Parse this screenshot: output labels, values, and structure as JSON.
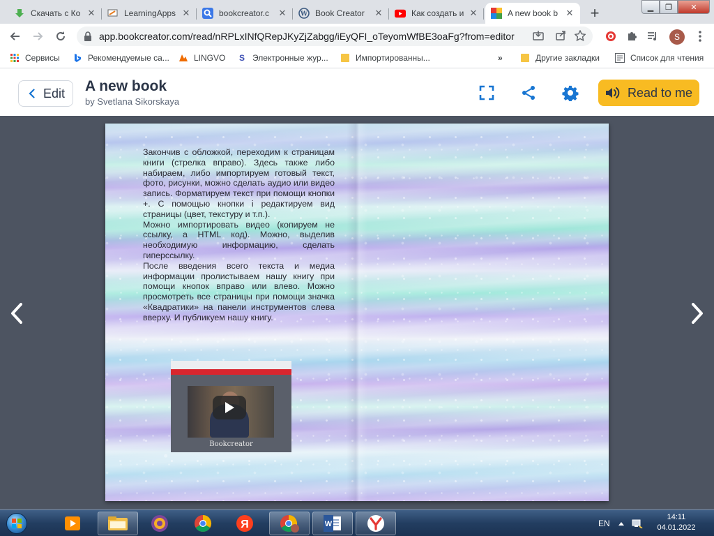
{
  "browser": {
    "tabs": [
      {
        "title": "Скачать с Ко",
        "icon": "download-icon"
      },
      {
        "title": "LearningApps",
        "icon": "learningapps-icon"
      },
      {
        "title": "bookcreator.c",
        "icon": "search-icon"
      },
      {
        "title": "Book Creator",
        "icon": "wordpress-icon"
      },
      {
        "title": "Как создать и",
        "icon": "youtube-icon"
      },
      {
        "title": "A new book b",
        "icon": "bookcreator-icon"
      }
    ],
    "url": "app.bookcreator.com/read/nRPLxINfQRepJKyZjZabgg/iEyQFI_oTeyomWfBE3oaFg?from=editor",
    "profile_initial": "S",
    "bookmarks": [
      {
        "label": "Сервисы",
        "icon": "apps-grid-icon"
      },
      {
        "label": "Рекомендуемые са...",
        "icon": "bing-icon"
      },
      {
        "label": "LINGVO",
        "icon": "lingvo-icon"
      },
      {
        "label": "Электронные жур...",
        "icon": "edu-icon"
      },
      {
        "label": "Импортированны...",
        "icon": "folder-icon"
      }
    ],
    "bookmarks_more": "»",
    "bookmarks_right": [
      {
        "label": "Другие закладки",
        "icon": "folder-icon"
      },
      {
        "label": "Список для чтения",
        "icon": "reading-list-icon"
      }
    ]
  },
  "app": {
    "edit_label": "Edit",
    "book_title": "A new book",
    "book_author": "by Svetlana Sikorskaya",
    "read_label": "Read to me",
    "accent": "#1976d2",
    "read_button_color": "#f8bb22"
  },
  "page": {
    "paragraphs": [
      "Закончив с обложкой, переходим к страницам книги (стрелка вправо). Здесь также либо набираем, либо импортируем готовый текст, фото, рисунки, можно сделать аудио или видео запись. Форматируем текст при помощи кнопки +. С помощью кнопки i редактируем вид страницы (цвет, текстуру и т.п.).",
      "Можно импортировать видео (копируем не ссылку, а HTML код). Можно, выделив необходимую информацию, сделать гиперссылку.",
      "После введения всего текста и медиа информации пролистываем нашу книгу при помощи кнопок вправо или влево. Можно просмотреть все страницы при помощи значка «Квадратики» на панели инструментов слева вверху. И публикуем нашу книгу."
    ],
    "video_caption": "Bookcreator"
  },
  "taskbar": {
    "apps": [
      "media-player-icon",
      "file-explorer-icon",
      "tor-browser-icon",
      "chrome-icon",
      "yandex-icon",
      "chrome-profile-icon",
      "word-icon",
      "yandex-browser-icon"
    ],
    "language": "EN",
    "time": "14:11",
    "date": "04.01.2022"
  }
}
